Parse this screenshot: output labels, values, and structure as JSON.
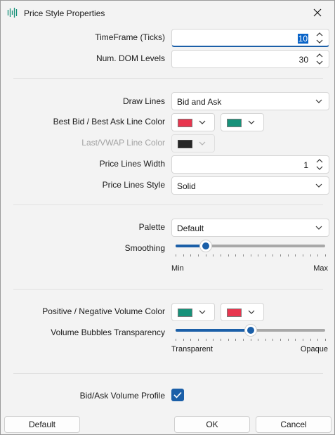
{
  "window": {
    "title": "Price Style Properties"
  },
  "icons": {
    "app": "price-chart-icon",
    "close": "close-icon"
  },
  "general": {
    "timeframe": {
      "label": "TimeFrame (Ticks)",
      "value": "10"
    },
    "dom_levels": {
      "label": "Num. DOM Levels",
      "value": "30"
    }
  },
  "lines": {
    "draw_lines": {
      "label": "Draw Lines",
      "value": "Bid and Ask"
    },
    "bid_ask_color": {
      "label": "Best Bid / Best Ask Line Color",
      "bid_color": "#e8364f",
      "ask_color": "#17927a"
    },
    "last_vwap_color": {
      "label": "Last/VWAP Line Color",
      "color": "#262626",
      "enabled": false
    },
    "width": {
      "label": "Price Lines Width",
      "value": "1"
    },
    "style": {
      "label": "Price Lines Style",
      "value": "Solid"
    }
  },
  "palette": {
    "label": "Palette",
    "value": "Default",
    "smoothing": {
      "label": "Smoothing",
      "min_label": "Min",
      "max_label": "Max",
      "level": 0.2
    }
  },
  "volume": {
    "color": {
      "label": "Positive / Negative Volume Color",
      "positive": "#17927a",
      "negative": "#e8364f"
    },
    "transparency": {
      "label": "Volume Bubbles Transparency",
      "min_label": "Transparent",
      "max_label": "Opaque",
      "level": 0.5
    }
  },
  "profile": {
    "label": "Bid/Ask Volume Profile",
    "checked": true
  },
  "buttons": {
    "default": "Default",
    "ok": "OK",
    "cancel": "Cancel"
  },
  "colors": {
    "accent": "#1b5fa8"
  }
}
